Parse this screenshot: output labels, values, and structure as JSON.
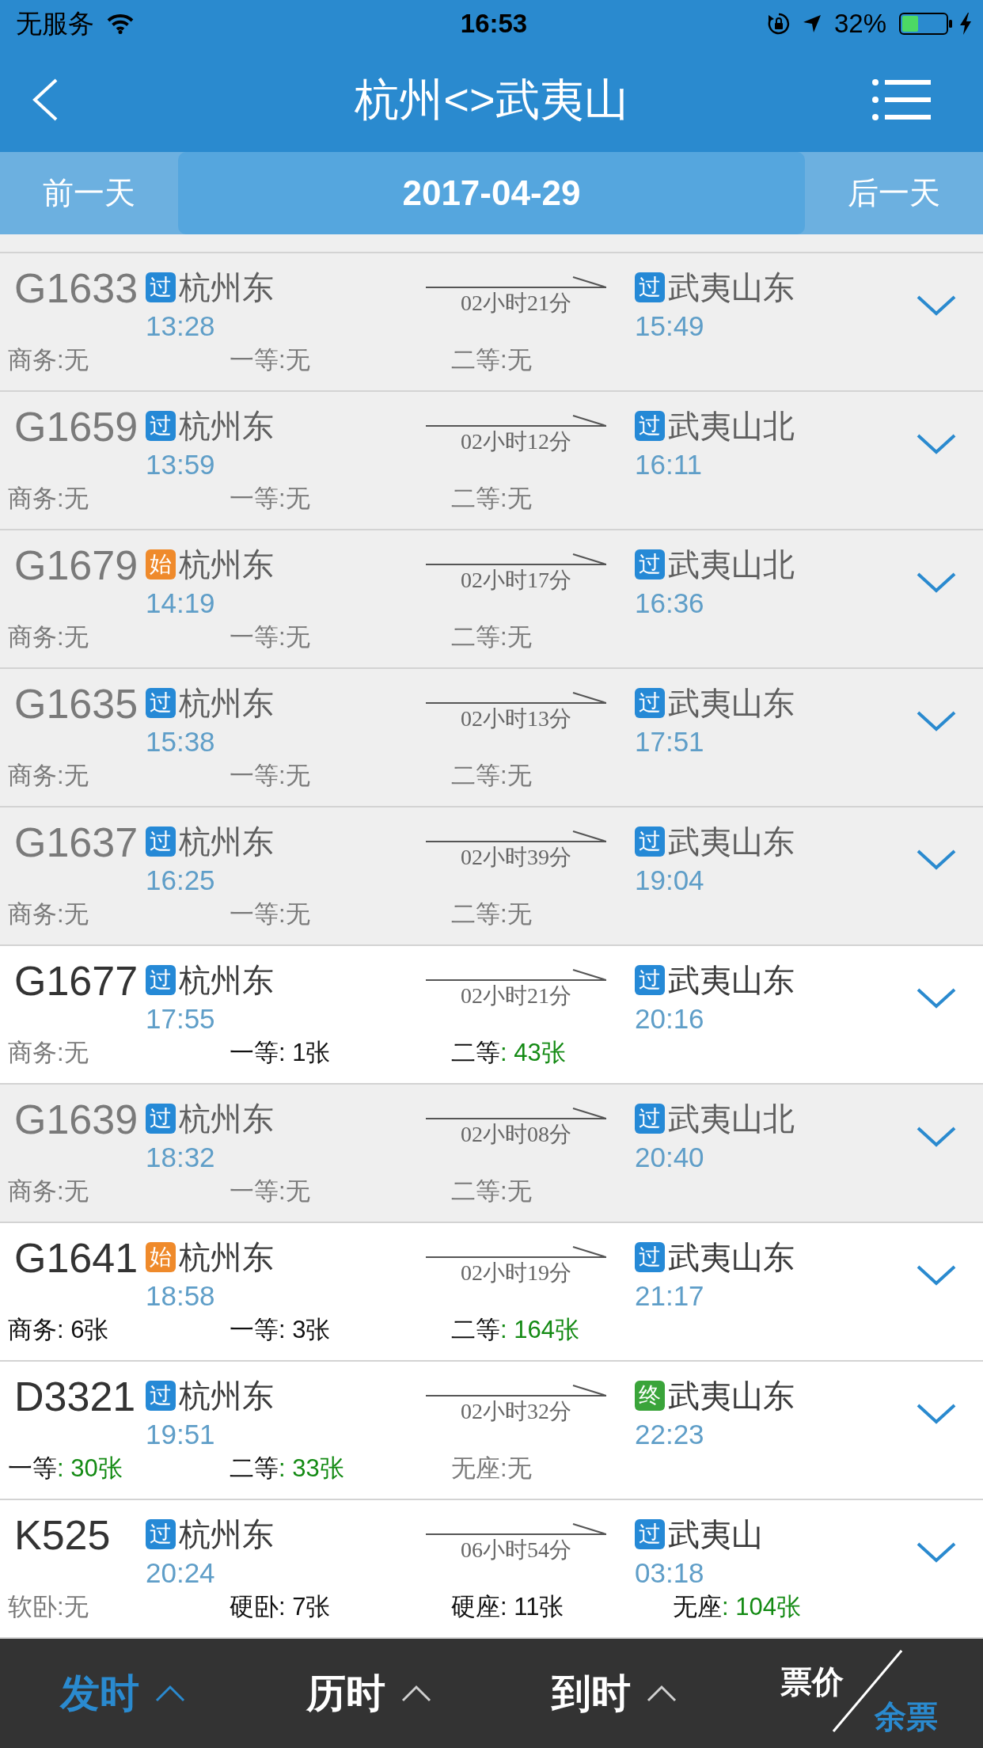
{
  "status_bar": {
    "carrier": "无服务",
    "time": "16:53",
    "battery": "32%"
  },
  "nav": {
    "title": "杭州<>武夷山"
  },
  "date_bar": {
    "prev": "前一天",
    "date": "2017-04-29",
    "next": "后一天"
  },
  "trains": [
    {
      "number": "G1633",
      "sold_out": true,
      "from": {
        "tag": "过",
        "color": "#2589d6",
        "station": "杭州东",
        "time": "13:28"
      },
      "duration": "02小时21分",
      "to": {
        "tag": "过",
        "color": "#2589d6",
        "station": "武夷山东",
        "time": "15:49"
      },
      "seats": [
        {
          "label": "商务",
          "value": ":无",
          "kind": "none"
        },
        {
          "label": "一等",
          "value": ":无",
          "kind": "none"
        },
        {
          "label": "二等",
          "value": ":无",
          "kind": "none"
        }
      ]
    },
    {
      "number": "G1659",
      "sold_out": true,
      "from": {
        "tag": "过",
        "color": "#2589d6",
        "station": "杭州东",
        "time": "13:59"
      },
      "duration": "02小时12分",
      "to": {
        "tag": "过",
        "color": "#2589d6",
        "station": "武夷山北",
        "time": "16:11"
      },
      "seats": [
        {
          "label": "商务",
          "value": ":无",
          "kind": "none"
        },
        {
          "label": "一等",
          "value": ":无",
          "kind": "none"
        },
        {
          "label": "二等",
          "value": ":无",
          "kind": "none"
        }
      ]
    },
    {
      "number": "G1679",
      "sold_out": true,
      "from": {
        "tag": "始",
        "color": "#ef8a2b",
        "station": "杭州东",
        "time": "14:19"
      },
      "duration": "02小时17分",
      "to": {
        "tag": "过",
        "color": "#2589d6",
        "station": "武夷山北",
        "time": "16:36"
      },
      "seats": [
        {
          "label": "商务",
          "value": ":无",
          "kind": "none"
        },
        {
          "label": "一等",
          "value": ":无",
          "kind": "none"
        },
        {
          "label": "二等",
          "value": ":无",
          "kind": "none"
        }
      ]
    },
    {
      "number": "G1635",
      "sold_out": true,
      "from": {
        "tag": "过",
        "color": "#2589d6",
        "station": "杭州东",
        "time": "15:38"
      },
      "duration": "02小时13分",
      "to": {
        "tag": "过",
        "color": "#2589d6",
        "station": "武夷山东",
        "time": "17:51"
      },
      "seats": [
        {
          "label": "商务",
          "value": ":无",
          "kind": "none"
        },
        {
          "label": "一等",
          "value": ":无",
          "kind": "none"
        },
        {
          "label": "二等",
          "value": ":无",
          "kind": "none"
        }
      ]
    },
    {
      "number": "G1637",
      "sold_out": true,
      "from": {
        "tag": "过",
        "color": "#2589d6",
        "station": "杭州东",
        "time": "16:25"
      },
      "duration": "02小时39分",
      "to": {
        "tag": "过",
        "color": "#2589d6",
        "station": "武夷山东",
        "time": "19:04"
      },
      "seats": [
        {
          "label": "商务",
          "value": ":无",
          "kind": "none"
        },
        {
          "label": "一等",
          "value": ":无",
          "kind": "none"
        },
        {
          "label": "二等",
          "value": ":无",
          "kind": "none"
        }
      ]
    },
    {
      "number": "G1677",
      "sold_out": false,
      "from": {
        "tag": "过",
        "color": "#2589d6",
        "station": "杭州东",
        "time": "17:55"
      },
      "duration": "02小时21分",
      "to": {
        "tag": "过",
        "color": "#2589d6",
        "station": "武夷山东",
        "time": "20:16"
      },
      "seats": [
        {
          "label": "商务",
          "value": ":无",
          "kind": "none"
        },
        {
          "label": "一等",
          "value": ": 1张",
          "kind": "some"
        },
        {
          "label": "二等",
          "value": ": 43张",
          "kind": "plenty"
        }
      ]
    },
    {
      "number": "G1639",
      "sold_out": true,
      "from": {
        "tag": "过",
        "color": "#2589d6",
        "station": "杭州东",
        "time": "18:32"
      },
      "duration": "02小时08分",
      "to": {
        "tag": "过",
        "color": "#2589d6",
        "station": "武夷山北",
        "time": "20:40"
      },
      "seats": [
        {
          "label": "商务",
          "value": ":无",
          "kind": "none"
        },
        {
          "label": "一等",
          "value": ":无",
          "kind": "none"
        },
        {
          "label": "二等",
          "value": ":无",
          "kind": "none"
        }
      ]
    },
    {
      "number": "G1641",
      "sold_out": false,
      "from": {
        "tag": "始",
        "color": "#ef8a2b",
        "station": "杭州东",
        "time": "18:58"
      },
      "duration": "02小时19分",
      "to": {
        "tag": "过",
        "color": "#2589d6",
        "station": "武夷山东",
        "time": "21:17"
      },
      "seats": [
        {
          "label": "商务",
          "value": ": 6张",
          "kind": "some"
        },
        {
          "label": "一等",
          "value": ": 3张",
          "kind": "some"
        },
        {
          "label": "二等",
          "value": ": 164张",
          "kind": "plenty"
        }
      ]
    },
    {
      "number": "D3321",
      "sold_out": false,
      "from": {
        "tag": "过",
        "color": "#2589d6",
        "station": "杭州东",
        "time": "19:51"
      },
      "duration": "02小时32分",
      "to": {
        "tag": "终",
        "color": "#3aa43a",
        "station": "武夷山东",
        "time": "22:23"
      },
      "seats": [
        {
          "label": "一等",
          "value": ": 30张",
          "kind": "plenty"
        },
        {
          "label": "二等",
          "value": ": 33张",
          "kind": "plenty"
        },
        {
          "label": "无座",
          "value": ":无",
          "kind": "none"
        }
      ]
    },
    {
      "number": "K525",
      "sold_out": false,
      "from": {
        "tag": "过",
        "color": "#2589d6",
        "station": "杭州东",
        "time": "20:24"
      },
      "duration": "06小时54分",
      "to": {
        "tag": "过",
        "color": "#2589d6",
        "station": "武夷山",
        "time": "03:18"
      },
      "seats": [
        {
          "label": "软卧",
          "value": ":无",
          "kind": "none"
        },
        {
          "label": "硬卧",
          "value": ": 7张",
          "kind": "some"
        },
        {
          "label": "硬座",
          "value": ": 11张",
          "kind": "some"
        },
        {
          "label": "无座",
          "value": ": 104张",
          "kind": "plenty"
        }
      ]
    }
  ],
  "sort_bar": {
    "tabs": [
      {
        "label": "发时",
        "selected": true
      },
      {
        "label": "历时",
        "selected": false
      },
      {
        "label": "到时",
        "selected": false
      }
    ],
    "toggle": [
      {
        "label": "票价",
        "selected": false
      },
      {
        "label": "余票",
        "selected": true
      }
    ]
  }
}
